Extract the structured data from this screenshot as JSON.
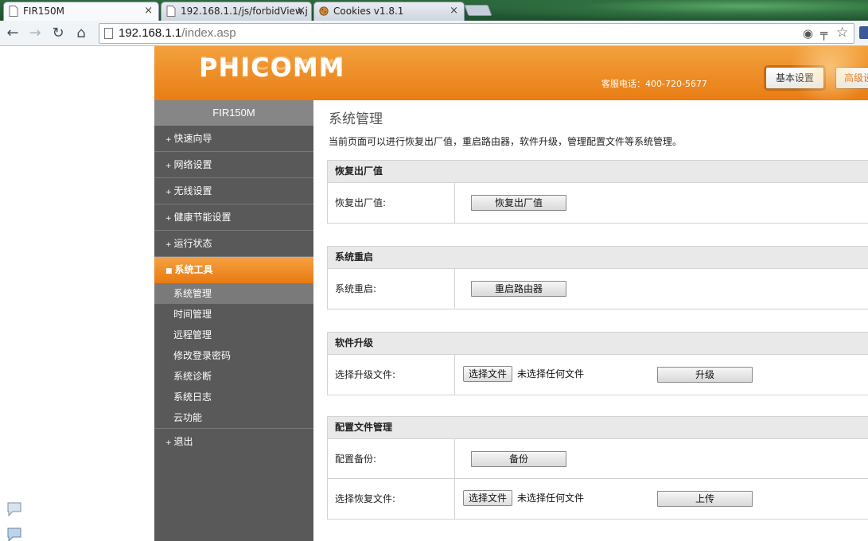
{
  "browser": {
    "tabs": [
      {
        "title": "FIR150M",
        "close": "×"
      },
      {
        "title": "192.168.1.1/js/forbidView.j",
        "close": "×"
      },
      {
        "title": "Cookies v1.8.1",
        "close": "×"
      }
    ],
    "url_host": "192.168.1.1",
    "url_path": "/index.asp",
    "nav": {
      "back": "←",
      "forward": "→",
      "reload": "↻",
      "home": "⌂"
    },
    "omni_icons": {
      "go": "◉",
      "key": "╤",
      "star": "☆"
    }
  },
  "header": {
    "logo": "PHICOMM",
    "hotline": "客服电话：400-720-5677",
    "buttons": [
      "基本设置",
      "高级设"
    ]
  },
  "sidebar": {
    "title": "FIR150M",
    "menu": [
      "快速向导",
      "网络设置",
      "无线设置",
      "健康节能设置",
      "运行状态"
    ],
    "open_menu": "系统工具",
    "submenu": [
      "系统管理",
      "时间管理",
      "远程管理",
      "修改登录密码",
      "系统诊断",
      "系统日志",
      "云功能"
    ],
    "exit": "退出",
    "bullet": "+",
    "open_bullet": "■"
  },
  "main": {
    "title": "系统管理",
    "description": "当前页面可以进行恢复出厂值，重启路由器，软件升级，管理配置文件等系统管理。",
    "sections": {
      "factory": {
        "head": "恢复出厂值",
        "label": "恢复出厂值:",
        "button": "恢复出厂值"
      },
      "reboot": {
        "head": "系统重启",
        "label": "系统重启:",
        "button": "重启路由器"
      },
      "upgrade": {
        "head": "软件升级",
        "label": "选择升级文件:",
        "file_button": "选择文件",
        "no_file": "未选择任何文件",
        "button": "升级"
      },
      "config": {
        "head": "配置文件管理",
        "backup_label": "配置备份:",
        "backup_button": "备份",
        "restore_label": "选择恢复文件:",
        "file_button": "选择文件",
        "no_file": "未选择任何文件",
        "upload_button": "上传"
      }
    }
  }
}
